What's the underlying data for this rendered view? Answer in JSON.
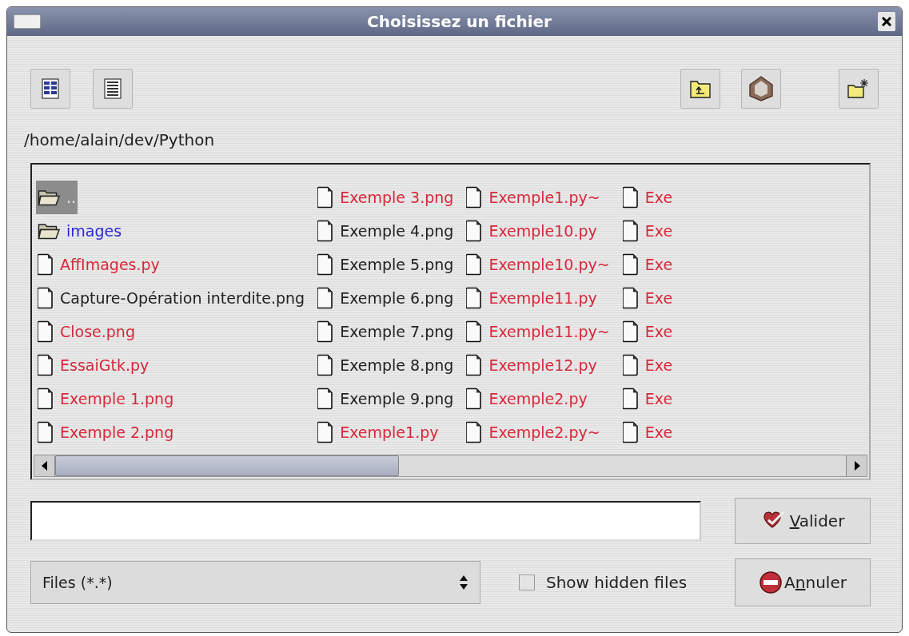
{
  "window": {
    "title": "Choisissez un fichier"
  },
  "path": "/home/alain/dev/Python",
  "columns": [
    {
      "items": [
        {
          "name": "..",
          "kind": "folder",
          "color": "#e8e8e8",
          "selected": true
        },
        {
          "name": "images",
          "kind": "folder",
          "color": "#2a2ad0",
          "selected": false
        },
        {
          "name": "AffImages.py",
          "kind": "file",
          "color": "#d6283a",
          "selected": false
        },
        {
          "name": "Capture-Opération interdite.png",
          "kind": "file",
          "color": "#222222",
          "selected": false
        },
        {
          "name": "Close.png",
          "kind": "file",
          "color": "#d6283a",
          "selected": false
        },
        {
          "name": "EssaiGtk.py",
          "kind": "file",
          "color": "#d6283a",
          "selected": false
        },
        {
          "name": "Exemple 1.png",
          "kind": "file",
          "color": "#d6283a",
          "selected": false
        },
        {
          "name": "Exemple 2.png",
          "kind": "file",
          "color": "#d6283a",
          "selected": false
        }
      ]
    },
    {
      "items": [
        {
          "name": "Exemple 3.png",
          "kind": "file",
          "color": "#d6283a",
          "selected": false
        },
        {
          "name": "Exemple 4.png",
          "kind": "file",
          "color": "#222222",
          "selected": false
        },
        {
          "name": "Exemple 5.png",
          "kind": "file",
          "color": "#222222",
          "selected": false
        },
        {
          "name": "Exemple 6.png",
          "kind": "file",
          "color": "#222222",
          "selected": false
        },
        {
          "name": "Exemple 7.png",
          "kind": "file",
          "color": "#222222",
          "selected": false
        },
        {
          "name": "Exemple 8.png",
          "kind": "file",
          "color": "#222222",
          "selected": false
        },
        {
          "name": "Exemple 9.png",
          "kind": "file",
          "color": "#222222",
          "selected": false
        },
        {
          "name": "Exemple1.py",
          "kind": "file",
          "color": "#d6283a",
          "selected": false
        }
      ]
    },
    {
      "items": [
        {
          "name": "Exemple1.py~",
          "kind": "file",
          "color": "#d6283a",
          "selected": false
        },
        {
          "name": "Exemple10.py",
          "kind": "file",
          "color": "#d6283a",
          "selected": false
        },
        {
          "name": "Exemple10.py~",
          "kind": "file",
          "color": "#d6283a",
          "selected": false
        },
        {
          "name": "Exemple11.py",
          "kind": "file",
          "color": "#d6283a",
          "selected": false
        },
        {
          "name": "Exemple11.py~",
          "kind": "file",
          "color": "#d6283a",
          "selected": false
        },
        {
          "name": "Exemple12.py",
          "kind": "file",
          "color": "#d6283a",
          "selected": false
        },
        {
          "name": "Exemple2.py",
          "kind": "file",
          "color": "#d6283a",
          "selected": false
        },
        {
          "name": "Exemple2.py~",
          "kind": "file",
          "color": "#d6283a",
          "selected": false
        }
      ]
    },
    {
      "items": [
        {
          "name": "Exe",
          "kind": "file",
          "color": "#d6283a",
          "selected": false
        },
        {
          "name": "Exe",
          "kind": "file",
          "color": "#d6283a",
          "selected": false
        },
        {
          "name": "Exe",
          "kind": "file",
          "color": "#d6283a",
          "selected": false
        },
        {
          "name": "Exe",
          "kind": "file",
          "color": "#d6283a",
          "selected": false
        },
        {
          "name": "Exe",
          "kind": "file",
          "color": "#d6283a",
          "selected": false
        },
        {
          "name": "Exe",
          "kind": "file",
          "color": "#d6283a",
          "selected": false
        },
        {
          "name": "Exe",
          "kind": "file",
          "color": "#d6283a",
          "selected": false
        },
        {
          "name": "Exe",
          "kind": "file",
          "color": "#d6283a",
          "selected": false
        }
      ]
    }
  ],
  "filter": {
    "value": "Files (*.*)"
  },
  "show_hidden": {
    "label": "Show hidden files",
    "checked": false
  },
  "buttons": [
    {
      "kind": "ok",
      "label_parts": [
        {
          "text": "V",
          "underlined": true
        },
        {
          "text": "alider",
          "underlined": false
        }
      ]
    },
    {
      "kind": "cancel",
      "label_parts": [
        {
          "text": "A",
          "underlined": false
        },
        {
          "text": "n",
          "underlined": true
        },
        {
          "text": "nuler",
          "underlined": false
        }
      ]
    }
  ]
}
